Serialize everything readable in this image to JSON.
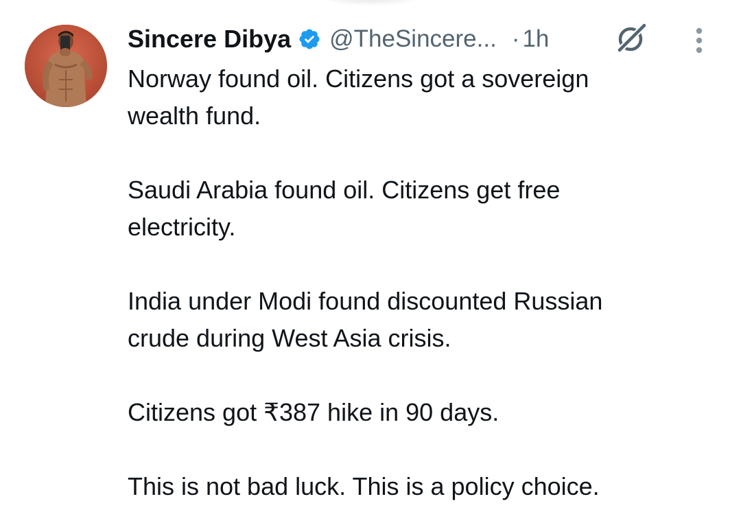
{
  "tweet": {
    "author": {
      "display_name": "Sincere Dibya",
      "handle": "@TheSincere...",
      "verified": true
    },
    "separator": "·",
    "time": "1h",
    "body_lines": [
      "Norway found oil. Citizens got a sovereign",
      "wealth fund.",
      "",
      "Saudi Arabia found oil. Citizens get free",
      "electricity.",
      "",
      "India under Modi found discounted Russian",
      "crude during West Asia crisis.",
      "",
      "Citizens got ₹387 hike in 90 days.",
      "",
      "This is not bad luck. This is a policy choice."
    ]
  },
  "icons": {
    "verified_badge": "verified-badge-icon",
    "grok": "grok-icon",
    "more": "more-vertical-icon"
  },
  "colors": {
    "text_primary": "#0f1419",
    "text_secondary": "#536471",
    "verified_blue": "#1d9bf0",
    "background": "#ffffff",
    "avatar_bg": "#c3523a"
  }
}
